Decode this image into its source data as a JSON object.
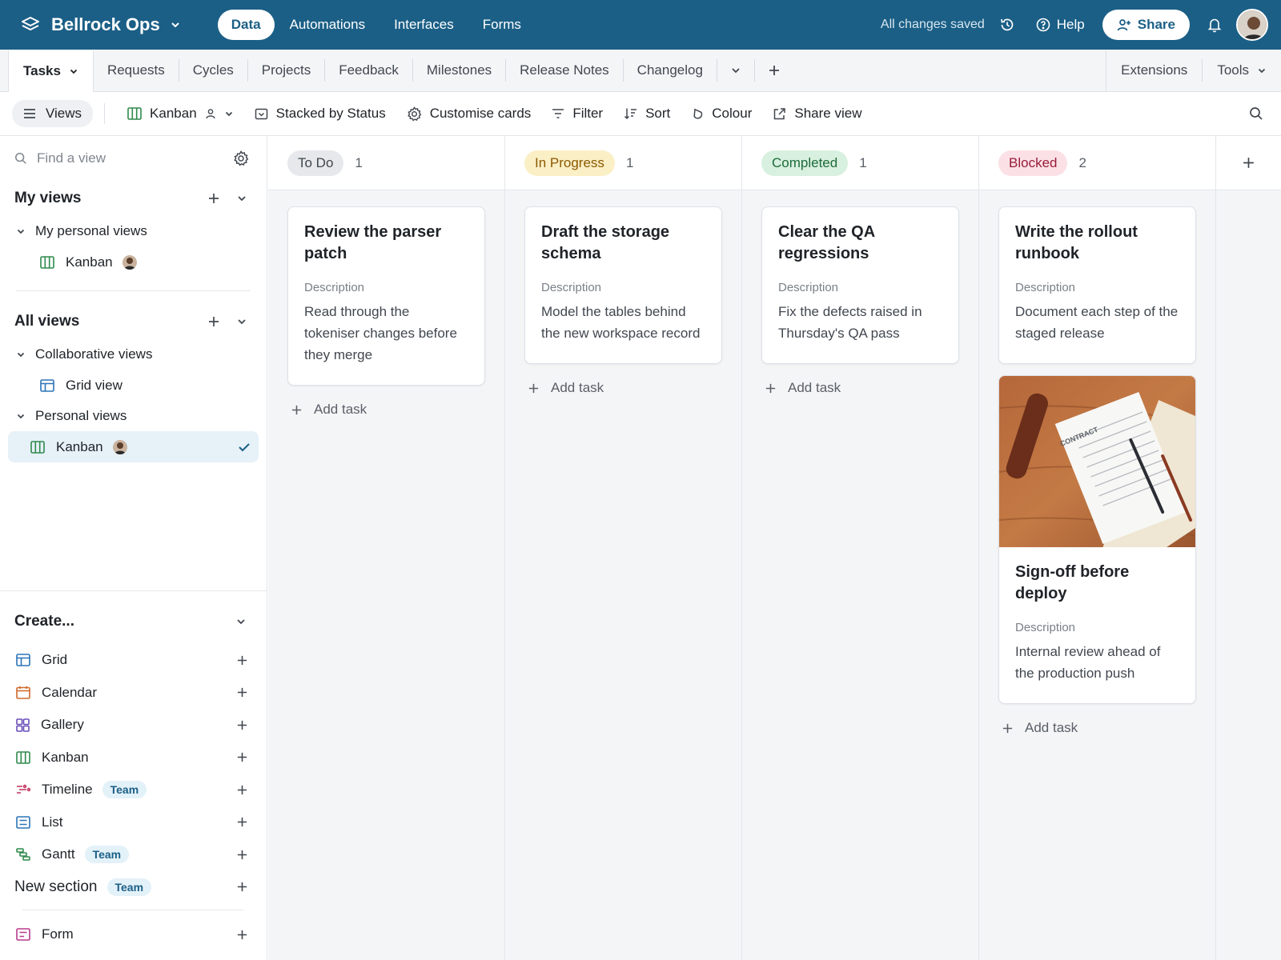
{
  "app": {
    "name": "Bellrock Ops",
    "nav": [
      "Data",
      "Automations",
      "Interfaces",
      "Forms"
    ],
    "active_nav": "Data",
    "saved_status": "All changes saved",
    "help_label": "Help",
    "share_label": "Share"
  },
  "tables": {
    "active": "Tasks",
    "items": [
      "Requests",
      "Cycles",
      "Projects",
      "Feedback",
      "Milestones",
      "Release Notes",
      "Changelog"
    ],
    "right": [
      "Extensions",
      "Tools"
    ]
  },
  "viewbar": {
    "views_label": "Views",
    "current_view": "Kanban",
    "stacked": "Stacked by Status",
    "customise": "Customise cards",
    "filter": "Filter",
    "sort": "Sort",
    "colour": "Colour",
    "share_view": "Share view"
  },
  "sidebar": {
    "find_placeholder": "Find a view",
    "my_views": {
      "title": "My views",
      "group": "My personal views",
      "items": [
        "Kanban"
      ]
    },
    "all_views": {
      "title": "All views",
      "groups": [
        {
          "name": "Collaborative views",
          "items": [
            "Grid view"
          ]
        },
        {
          "name": "Personal views",
          "items": [
            "Kanban"
          ]
        }
      ],
      "selected": "Kanban"
    },
    "create": {
      "title": "Create...",
      "items": [
        {
          "label": "Grid",
          "badge": ""
        },
        {
          "label": "Calendar",
          "badge": ""
        },
        {
          "label": "Gallery",
          "badge": ""
        },
        {
          "label": "Kanban",
          "badge": ""
        },
        {
          "label": "Timeline",
          "badge": "Team"
        },
        {
          "label": "List",
          "badge": ""
        },
        {
          "label": "Gantt",
          "badge": "Team"
        }
      ],
      "section": {
        "label": "New section",
        "badge": "Team"
      },
      "form": "Form"
    }
  },
  "board": {
    "add_task_label": "Add task",
    "field_label": "Description",
    "columns": [
      {
        "status": "To Do",
        "count": "1",
        "pill_bg": "#e6e8eb",
        "pill_fg": "#41474f",
        "cards": [
          {
            "title": "Review the parser patch",
            "description": "Read through the tokeniser changes before they merge"
          }
        ]
      },
      {
        "status": "In Progress",
        "count": "1",
        "pill_bg": "#fbefc6",
        "pill_fg": "#8a5a00",
        "cards": [
          {
            "title": "Draft the storage schema",
            "description": "Model the tables behind the new workspace record"
          }
        ]
      },
      {
        "status": "Completed",
        "count": "1",
        "pill_bg": "#d8f0df",
        "pill_fg": "#1e6b3a",
        "cards": [
          {
            "title": "Clear the QA regressions",
            "description": "Fix the defects raised in Thursday's QA pass"
          }
        ]
      },
      {
        "status": "Blocked",
        "count": "2",
        "pill_bg": "#fbe1e6",
        "pill_fg": "#9b1c3a",
        "cards": [
          {
            "title": "Write the rollout runbook",
            "description": "Document each step of the staged release"
          },
          {
            "title": "Sign-off before deploy",
            "description": "Internal review ahead of the production push",
            "cover_text": "CONTRACT"
          }
        ]
      }
    ]
  },
  "colors": {
    "brand": "#1b5f86",
    "selected_bg": "#e6f1f8",
    "board_bg": "#f4f5f7"
  }
}
